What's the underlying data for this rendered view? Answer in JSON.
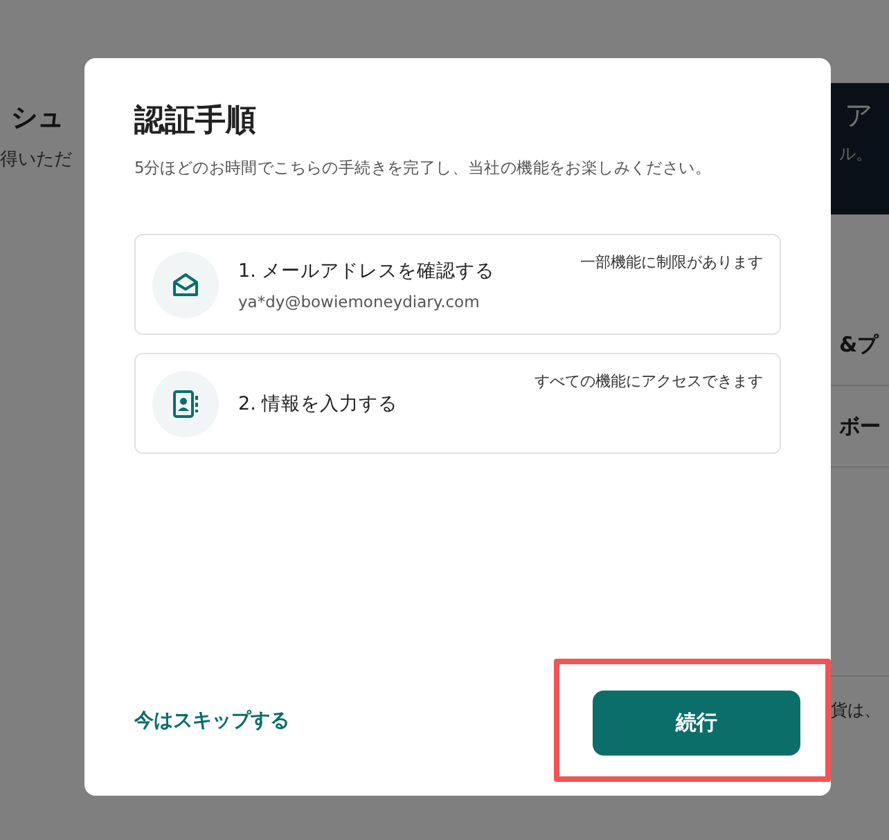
{
  "background_page": {
    "left_heading": "シュ",
    "left_subtitle": "得いただ",
    "right_banner_lines": [
      "ア",
      "ル。"
    ],
    "right_items": [
      "&プ",
      "ボー"
    ],
    "right_note": "貨は、"
  },
  "dialog": {
    "title": "認証手順",
    "subtitle": "5分ほどのお時間でこちらの手続きを完了し、当社の機能をお楽しみください。",
    "steps": [
      {
        "kind": "email",
        "title": "1. メールアドレスを確認する",
        "detail": "ya*dy@bowiemoneydiary.com",
        "note": "一部機能に制限があります"
      },
      {
        "kind": "profile",
        "title": "2. 情報を入力する",
        "note": "すべての機能にアクセスできます"
      }
    ],
    "skip_link": "今はスキップする",
    "continue_button": "続行",
    "continue_highlighted": true
  }
}
